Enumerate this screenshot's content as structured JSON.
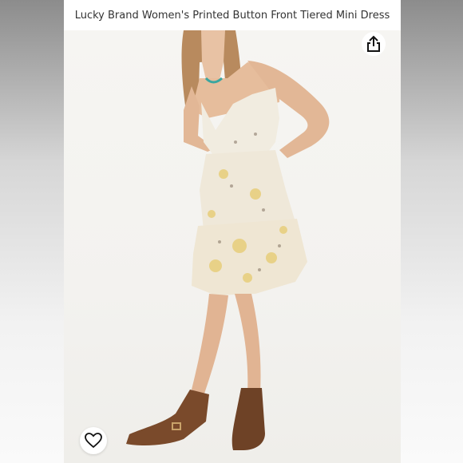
{
  "product": {
    "title": "Lucky Brand Women's Printed Button Front Tiered Mini Dress"
  },
  "actions": {
    "share_icon": "share-icon",
    "wishlist_icon": "heart-icon"
  },
  "colors": {
    "background": "#f4f3f0",
    "dress": "#f1ece0",
    "print_yellow": "#e8cf7f",
    "boots": "#7a4a2b",
    "hair": "#b88a5e"
  }
}
